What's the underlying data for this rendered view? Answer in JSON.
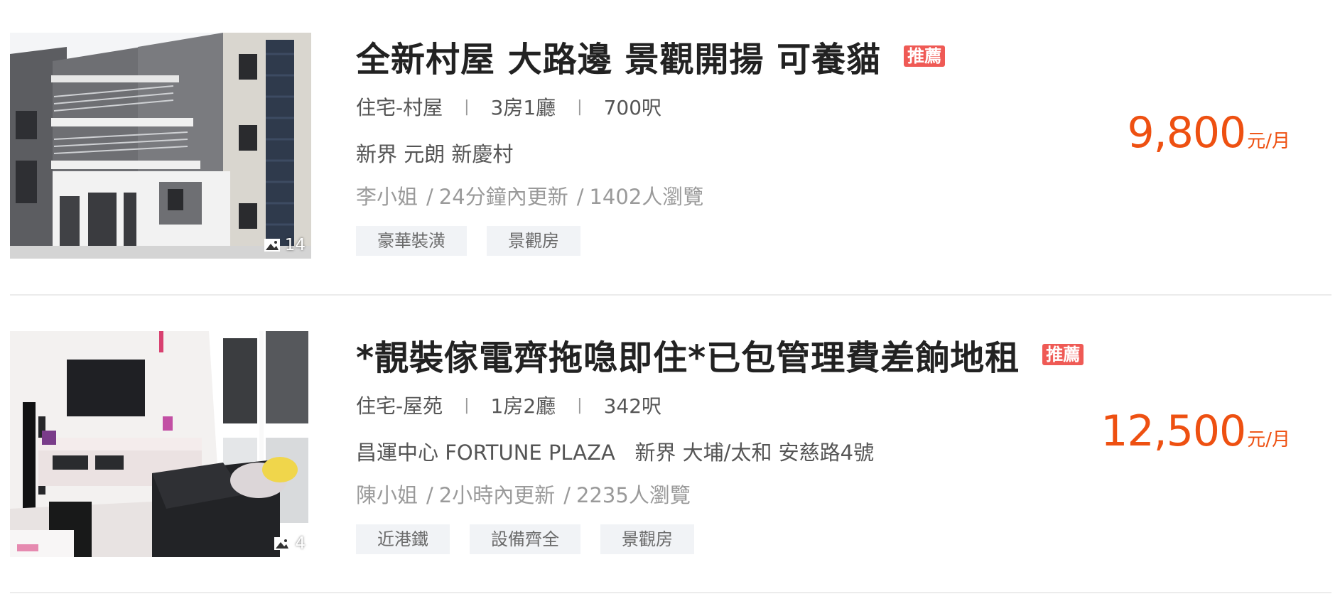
{
  "listings": [
    {
      "title": "全新村屋 大路邊 景觀開揚 可養貓",
      "badge": "推薦",
      "photo_count": "14",
      "type": "住宅-村屋",
      "rooms": "3房1廳",
      "area": "700呎",
      "address": "新界 元朗 新慶村",
      "agent": "李小姐",
      "updated": "24分鐘內更新",
      "views": "1402人瀏覽",
      "tags": [
        "豪華裝潢",
        "景觀房"
      ],
      "price": "9,800",
      "price_unit": "元/月"
    },
    {
      "title": "*靚裝傢電齊拖喼即住*已包管理費差餉地租",
      "badge": "推薦",
      "photo_count": "4",
      "type": "住宅-屋苑",
      "rooms": "1房2廳",
      "area": "342呎",
      "address": "昌運中心 FORTUNE PLAZA   新界 大埔/太和 安慈路4號",
      "agent": "陳小姐",
      "updated": "2小時內更新",
      "views": "2235人瀏覽",
      "tags": [
        "近港鐵",
        "設備齊全",
        "景觀房"
      ],
      "price": "12,500",
      "price_unit": "元/月"
    }
  ],
  "separators": {
    "meta": "|",
    "sub": "/"
  },
  "colors": {
    "price": "#ee5011",
    "badge": "#ef5a55",
    "tag_bg": "#f1f3f6"
  }
}
